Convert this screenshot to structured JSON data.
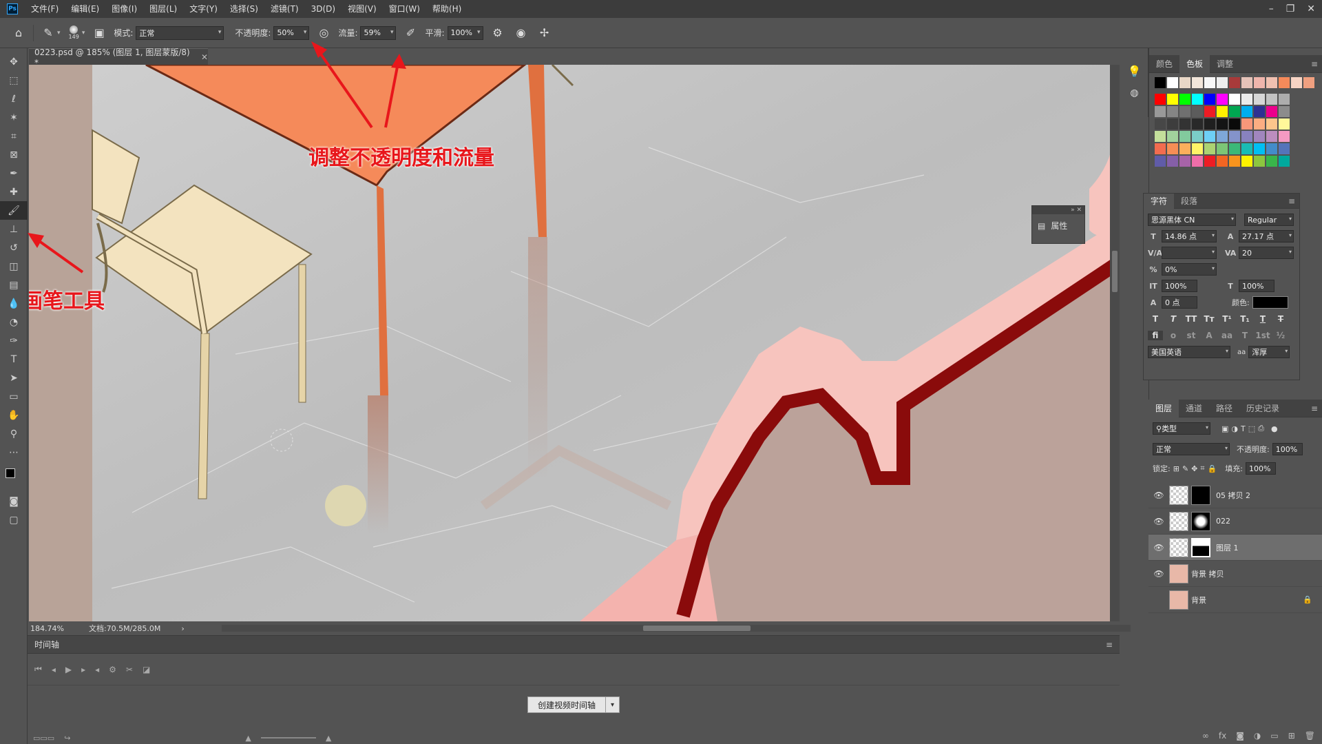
{
  "menubar": {
    "logo": "Ps",
    "items": [
      "文件(F)",
      "编辑(E)",
      "图像(I)",
      "图层(L)",
      "文字(Y)",
      "选择(S)",
      "滤镜(T)",
      "3D(D)",
      "视图(V)",
      "窗口(W)",
      "帮助(H)"
    ]
  },
  "window_controls": [
    "–",
    "❐",
    "✕"
  ],
  "options": {
    "brush_size": "149",
    "mode_label": "模式:",
    "mode_value": "正常",
    "opacity_label": "不透明度:",
    "opacity_value": "50%",
    "flow_label": "流量:",
    "flow_value": "59%",
    "smooth_label": "平滑:",
    "smooth_value": "100%"
  },
  "document": {
    "tab_title": "0223.psd @ 185% (图层 1, 图层蒙版/8) *",
    "zoom": "184.74%",
    "doc_info": "文档:70.5M/285.0M"
  },
  "annotations": {
    "adjust": "调整不透明度和流量",
    "brush_tool": "画笔工具"
  },
  "timeline": {
    "title": "时间轴",
    "create_button": "创建视频时间轴"
  },
  "color_panel": {
    "tabs": [
      "颜色",
      "色板",
      "调整"
    ],
    "active_tab": 1
  },
  "char_panel": {
    "tabs": [
      "字符",
      "段落"
    ],
    "font_family": "思源黑体 CN",
    "font_style": "Regular",
    "font_size": "14.86 点",
    "leading": "27.17 点",
    "kerning": "",
    "tracking": "20",
    "tsume": "0%",
    "vscale": "100%",
    "hscale": "100%",
    "baseline": "0 点",
    "color_label": "颜色:",
    "language": "美国英语",
    "antialias": "浑厚",
    "aa_label": "aa"
  },
  "props_float": {
    "label": "属性"
  },
  "layers_panel": {
    "tabs": [
      "图层",
      "通道",
      "路径",
      "历史记录"
    ],
    "filter_label": "类型",
    "blend_mode": "正常",
    "opacity_label": "不透明度:",
    "opacity_value": "100%",
    "lock_label": "锁定:",
    "fill_label": "填充:",
    "fill_value": "100%",
    "layers": [
      {
        "name": "05 拷贝 2",
        "visible": true
      },
      {
        "name": "022",
        "visible": true
      },
      {
        "name": "图层 1",
        "visible": true,
        "selected": true
      },
      {
        "name": "背景 拷贝",
        "visible": true
      },
      {
        "name": "背景",
        "visible": false,
        "locked": true
      }
    ]
  },
  "colors": {
    "accent_red": "#e8161b",
    "table_orange": "#f58a5a",
    "chair_cream": "#f3e3bf",
    "wall_pink": "#f4b3ae",
    "wall_dark": "#8a0b0b"
  }
}
